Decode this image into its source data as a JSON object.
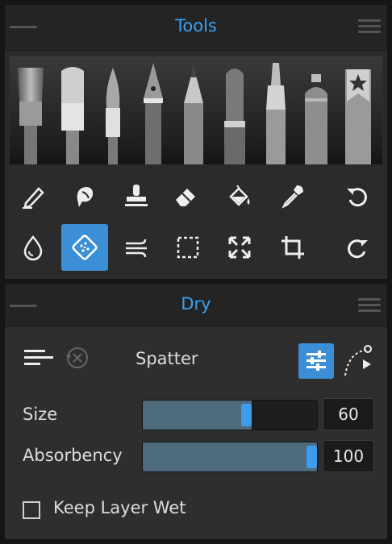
{
  "tools_panel": {
    "title": "Tools",
    "brushes": [
      "flat-brush-icon",
      "wide-brush-icon",
      "round-brush-icon",
      "ink-pen-icon",
      "pencil-icon",
      "marker-icon",
      "felt-pen-icon",
      "airbrush-can-icon",
      "bookmark-star-icon"
    ],
    "tool_row1": [
      "pencil-tool-icon",
      "smudge-tool-icon",
      "stamp-tool-icon",
      "eraser-tool-icon",
      "fill-bucket-icon",
      "eyedropper-icon",
      "undo-icon"
    ],
    "tool_row2": [
      "water-drop-icon",
      "spatter-tool-icon",
      "blow-dry-icon",
      "selection-rect-icon",
      "transform-icon",
      "crop-icon",
      "redo-icon"
    ],
    "selected_tool": "spatter-tool-icon"
  },
  "dry_panel": {
    "title": "Dry",
    "brush_name": "Spatter",
    "size_label": "Size",
    "size_value": "60",
    "size_fraction": 0.6,
    "absorbency_label": "Absorbency",
    "absorbency_value": "100",
    "absorbency_fraction": 1.0,
    "keep_wet_label": "Keep Layer Wet",
    "keep_wet_checked": false
  },
  "colors": {
    "accent": "#3b8fd6",
    "title": "#3aa0f0",
    "panel": "#2b2b2b"
  }
}
